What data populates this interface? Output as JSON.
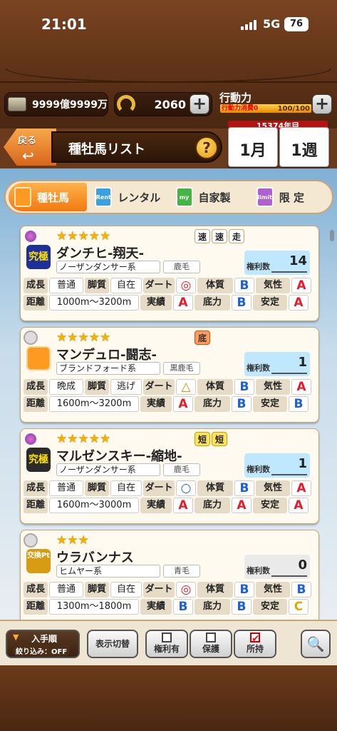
{
  "status": {
    "time": "21:01",
    "network": "5G",
    "battery": "76"
  },
  "header": {
    "money": "9999億9999万",
    "horseshoe": "2060",
    "stamina_label": "行動力",
    "stamina_consume": "行動力消費0",
    "stamina_value": "100/100",
    "plus": "+"
  },
  "nav": {
    "back_label": "戻る",
    "back_arrow": "↩",
    "title": "種牡馬リスト",
    "help": "?"
  },
  "calendar": {
    "year": "15374年目",
    "month": "1月",
    "week": "1週"
  },
  "tabs": [
    {
      "label": "種牡馬",
      "icon": "document-icon",
      "active": true
    },
    {
      "label": "レンタル",
      "icon": "Rent",
      "active": false
    },
    {
      "label": "自家製",
      "icon": "my",
      "active": false
    },
    {
      "label": "限 定",
      "icon": "limit",
      "active": false
    }
  ],
  "labels": {
    "growth": "成長",
    "leg": "脚質",
    "dirt": "ダート",
    "body": "体質",
    "temper": "気性",
    "distance": "距離",
    "record": "実績",
    "stamina": "底力",
    "stability": "安定",
    "rights": "権利数"
  },
  "stallions": [
    {
      "stars": "★★★★★",
      "tags": [
        "速",
        "速",
        "走"
      ],
      "name": "ダンチヒ-翔天-",
      "lineage": "ノーザンダンサー系",
      "coat": "鹿毛",
      "rights": "14",
      "avatar": "究極",
      "growth": "普通",
      "leg": "自在",
      "dirt": "◎",
      "body": "B",
      "temper": "A",
      "distance": "1000m〜3200m",
      "record": "A",
      "stamina": "B",
      "stability": "A"
    },
    {
      "stars": "★★★★★",
      "tags": [
        "底"
      ],
      "name": "マンデュロ-闘志-",
      "lineage": "ブランドフォード系",
      "coat": "黒鹿毛",
      "rights": "1",
      "avatar": "",
      "growth": "晩成",
      "leg": "逃げ",
      "dirt": "△",
      "body": "B",
      "temper": "A",
      "distance": "1600m〜3200m",
      "record": "A",
      "stamina": "B",
      "stability": "B"
    },
    {
      "stars": "★★★★★",
      "tags": [
        "短",
        "短"
      ],
      "name": "マルゼンスキー-縮地-",
      "lineage": "ノーザンダンサー系",
      "coat": "鹿毛",
      "rights": "1",
      "avatar": "究極",
      "growth": "普通",
      "leg": "自在",
      "dirt": "○",
      "body": "B",
      "temper": "A",
      "distance": "1600m〜3000m",
      "record": "A",
      "stamina": "A",
      "stability": "A"
    },
    {
      "stars": "★★★",
      "tags": [],
      "name": "ウラバンナス",
      "lineage": "ヒムヤー系",
      "coat": "青毛",
      "rights": "0",
      "avatar": "交換Pt",
      "growth": "普通",
      "leg": "自在",
      "dirt": "◎",
      "body": "B",
      "temper": "B",
      "distance": "1300m〜1800m",
      "record": "B",
      "stamina": "B",
      "stability": "C"
    }
  ],
  "bottom": {
    "sort_label": "入手順",
    "sort_arrow": "▼",
    "filter_label": "絞り込み：OFF",
    "toggle_label": "表示切替",
    "filter1": "権利有",
    "filter2": "保護",
    "filter3": "所持",
    "search_icon": "magnifier-icon"
  }
}
